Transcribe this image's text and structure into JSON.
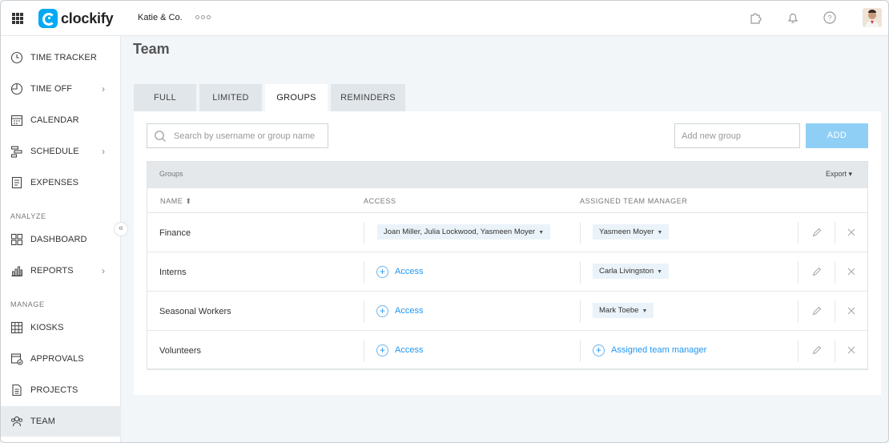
{
  "app": {
    "name": "clockify",
    "workspace": "Katie & Co."
  },
  "sidebar": {
    "items": [
      {
        "label": "TIME TRACKER",
        "icon": "clock-icon"
      },
      {
        "label": "TIME OFF",
        "icon": "time-off-icon",
        "chevron": "›"
      },
      {
        "label": "CALENDAR",
        "icon": "calendar-icon"
      },
      {
        "label": "SCHEDULE",
        "icon": "schedule-icon",
        "chevron": "›"
      },
      {
        "label": "EXPENSES",
        "icon": "expenses-icon"
      },
      {
        "label": "DASHBOARD",
        "icon": "dashboard-icon"
      },
      {
        "label": "REPORTS",
        "icon": "reports-icon",
        "chevron": "›"
      },
      {
        "label": "KIOSKS",
        "icon": "kiosks-icon"
      },
      {
        "label": "APPROVALS",
        "icon": "approvals-icon"
      },
      {
        "label": "PROJECTS",
        "icon": "projects-icon"
      },
      {
        "label": "TEAM",
        "icon": "team-icon",
        "active": true
      }
    ],
    "sections": {
      "analyze": "ANALYZE",
      "manage": "MANAGE"
    },
    "collapse_glyph": "«"
  },
  "page": {
    "title": "Team"
  },
  "tabs": [
    {
      "label": "FULL"
    },
    {
      "label": "LIMITED"
    },
    {
      "label": "GROUPS",
      "active": true
    },
    {
      "label": "REMINDERS"
    }
  ],
  "toolbar": {
    "search_placeholder": "Search by username or group name",
    "add_group_placeholder": "Add new group",
    "add_label": "ADD"
  },
  "table": {
    "title": "Groups",
    "export_label": "Export ▾",
    "columns": {
      "name": "NAME ⬆",
      "access": "ACCESS",
      "manager": "ASSIGNED TEAM MANAGER"
    },
    "rows": [
      {
        "name": "Finance",
        "access": "Joan Miller, Julia Lockwood, Yasmeen Moyer",
        "manager": "Yasmeen Moyer"
      },
      {
        "name": "Interns",
        "access": "",
        "access_link": "Access",
        "manager": "Carla Livingston"
      },
      {
        "name": "Seasonal Workers",
        "access": "",
        "access_link": "Access",
        "manager": "Mark Toebe"
      },
      {
        "name": "Volunteers",
        "access": "",
        "access_link": "Access",
        "manager": "",
        "manager_link": "Assigned team manager"
      }
    ]
  },
  "colors": {
    "accent": "#03a9f4",
    "add_button": "#90cff5",
    "link": "#2196f3",
    "chip_bg": "#eaf3f9"
  }
}
